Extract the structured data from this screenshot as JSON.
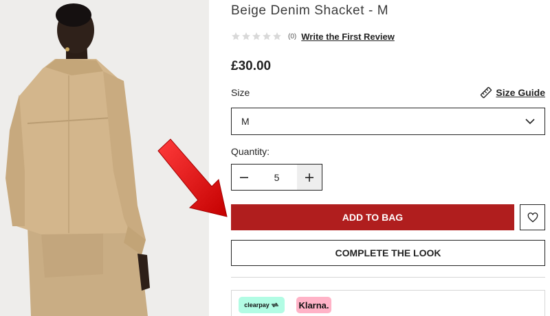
{
  "product": {
    "title": "Beige Denim Shacket - M",
    "price": "£30.00",
    "image_icon": "product-photo"
  },
  "rating": {
    "stars_filled": 0,
    "stars_total": 5,
    "count": "(0)",
    "review_link": "Write the First Review"
  },
  "size": {
    "label": "Size",
    "guide_label": "Size Guide",
    "selected": "M"
  },
  "quantity": {
    "label": "Quantity:",
    "value": "5"
  },
  "actions": {
    "add_to_bag": "ADD TO BAG",
    "complete_look": "COMPLETE THE LOOK"
  },
  "payments": {
    "clearpay": "clearpay",
    "klarna": "Klarna."
  },
  "colors": {
    "add_to_bag_bg": "#b01e1e",
    "clearpay_bg": "#b2fce4",
    "klarna_bg": "#ffb3c7",
    "annotation_arrow": "#e11515"
  }
}
